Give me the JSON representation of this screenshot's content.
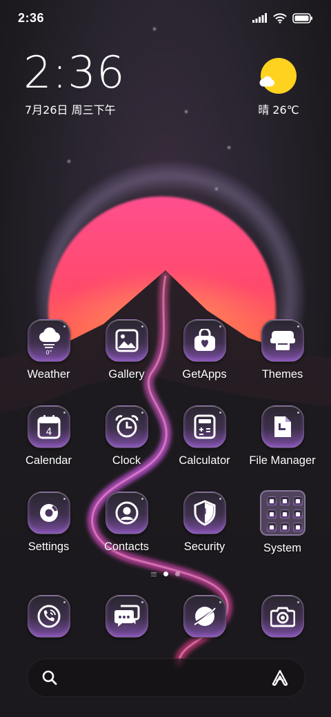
{
  "status_bar": {
    "time": "2:36",
    "signal_icon": "signal-bars-icon",
    "wifi_icon": "wifi-icon",
    "battery_icon": "battery-icon"
  },
  "clock_widget": {
    "time": "2:36",
    "date": "7月26日 周三下午"
  },
  "weather_widget": {
    "icon": "sun-cloud-icon",
    "text": "晴 26℃"
  },
  "apps": [
    [
      {
        "label": "Weather",
        "icon": "weather-cloud-icon"
      },
      {
        "label": "Gallery",
        "icon": "gallery-image-icon"
      },
      {
        "label": "GetApps",
        "icon": "getapps-bag-icon"
      },
      {
        "label": "Themes",
        "icon": "themes-printer-icon"
      }
    ],
    [
      {
        "label": "Calendar",
        "icon": "calendar-icon"
      },
      {
        "label": "Clock",
        "icon": "alarm-clock-icon"
      },
      {
        "label": "Calculator",
        "icon": "calculator-icon"
      },
      {
        "label": "File Manager",
        "icon": "file-icon"
      }
    ],
    [
      {
        "label": "Settings",
        "icon": "settings-gear-icon"
      },
      {
        "label": "Contacts",
        "icon": "contacts-person-icon"
      },
      {
        "label": "Security",
        "icon": "security-shield-icon"
      },
      {
        "label": "System",
        "icon": "folder-icon"
      }
    ]
  ],
  "weather_icon_text": "0°",
  "calendar_day": "4",
  "page_indicator": {
    "pages": 2,
    "active": 1
  },
  "dock": [
    {
      "icon": "phone-icon"
    },
    {
      "icon": "messages-icon"
    },
    {
      "icon": "browser-planet-icon"
    },
    {
      "icon": "camera-icon"
    }
  ],
  "search_bar": {
    "search_icon": "search-icon",
    "assistant_icon": "assistant-logo-icon"
  },
  "colors": {
    "sun": "#ff4f8e",
    "icon_accent": "#7a4ea1",
    "weather_sun": "#ffd21f"
  }
}
